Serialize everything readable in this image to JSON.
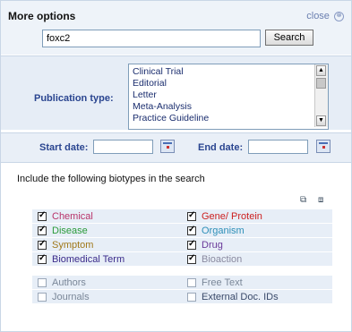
{
  "panel": {
    "title": "More options",
    "close_label": "close",
    "close_icon": "⊗"
  },
  "search": {
    "value": "foxc2",
    "button_label": "Search"
  },
  "publication": {
    "label": "Publication type:",
    "options": [
      "Clinical Trial",
      "Editorial",
      "Letter",
      "Meta-Analysis",
      "Practice Guideline"
    ]
  },
  "dates": {
    "start_label": "Start date:",
    "end_label": "End date:",
    "start_value": "",
    "end_value": ""
  },
  "biotypes": {
    "intro": "Include the following biotypes in the search",
    "items": [
      {
        "label": "Chemical",
        "checked": true,
        "color": "#b8336a"
      },
      {
        "label": "Gene/ Protein",
        "checked": true,
        "color": "#cc1f1f"
      },
      {
        "label": "Disease",
        "checked": true,
        "color": "#2a9a3a"
      },
      {
        "label": "Organism",
        "checked": true,
        "color": "#2d8fb8"
      },
      {
        "label": "Symptom",
        "checked": true,
        "color": "#a0781a"
      },
      {
        "label": "Drug",
        "checked": true,
        "color": "#6a3a9a"
      },
      {
        "label": "Biomedical Term",
        "checked": true,
        "color": "#3a2a8a"
      },
      {
        "label": "Bioaction",
        "checked": true,
        "color": "#8a8aa0"
      },
      {
        "label": "Authors",
        "checked": false,
        "color": "#7a8798"
      },
      {
        "label": "Free Text",
        "checked": false,
        "color": "#7a8798"
      },
      {
        "label": "Journals",
        "checked": false,
        "color": "#7a8798"
      },
      {
        "label": "External Doc. IDs",
        "checked": false,
        "color": "#3a4a6a"
      }
    ]
  }
}
